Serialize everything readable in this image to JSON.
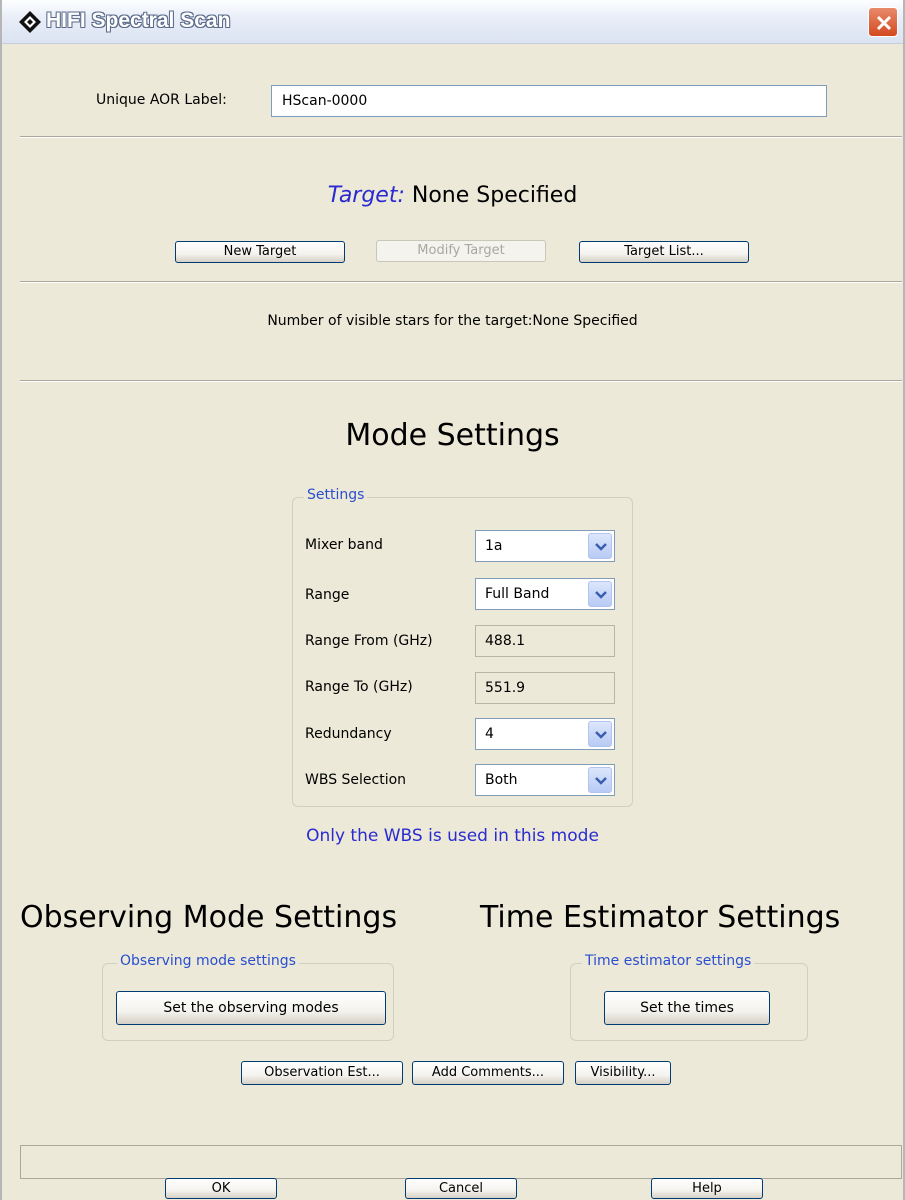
{
  "window": {
    "title": "HIFI Spectral Scan"
  },
  "aor": {
    "label": "Unique AOR Label:",
    "value": "HScan-0000"
  },
  "target": {
    "key": "Target:",
    "value": "None Specified",
    "buttons": {
      "new": "New Target",
      "modify": "Modify Target",
      "list": "Target List..."
    },
    "stars_text": "Number of visible stars for the target:None Specified"
  },
  "mode": {
    "title": "Mode Settings",
    "group_label": "Settings",
    "fields": {
      "mixer_band": {
        "label": "Mixer band",
        "value": "1a"
      },
      "range": {
        "label": "Range",
        "value": "Full Band"
      },
      "range_from": {
        "label": "Range From (GHz)",
        "value": "488.1"
      },
      "range_to": {
        "label": "Range To (GHz)",
        "value": "551.9"
      },
      "redundancy": {
        "label": "Redundancy",
        "value": "4"
      },
      "wbs_selection": {
        "label": "WBS Selection",
        "value": "Both"
      }
    },
    "info": "Only the WBS is used in this mode"
  },
  "observing": {
    "title": "Observing Mode Settings",
    "group_label": "Observing mode settings",
    "button": "Set the observing modes"
  },
  "time_estimator": {
    "title": "Time Estimator Settings",
    "group_label": "Time estimator settings",
    "button": "Set the times"
  },
  "actions": {
    "observation_est": "Observation Est...",
    "add_comments": "Add Comments...",
    "visibility": "Visibility..."
  },
  "footer": {
    "ok": "OK",
    "cancel": "Cancel",
    "help": "Help"
  },
  "colors": {
    "dialog_bg": "#ece9d8",
    "accent_blue": "#2a2ad0",
    "group_label_blue": "#2a4ed0",
    "close_red": "#d34a20"
  }
}
